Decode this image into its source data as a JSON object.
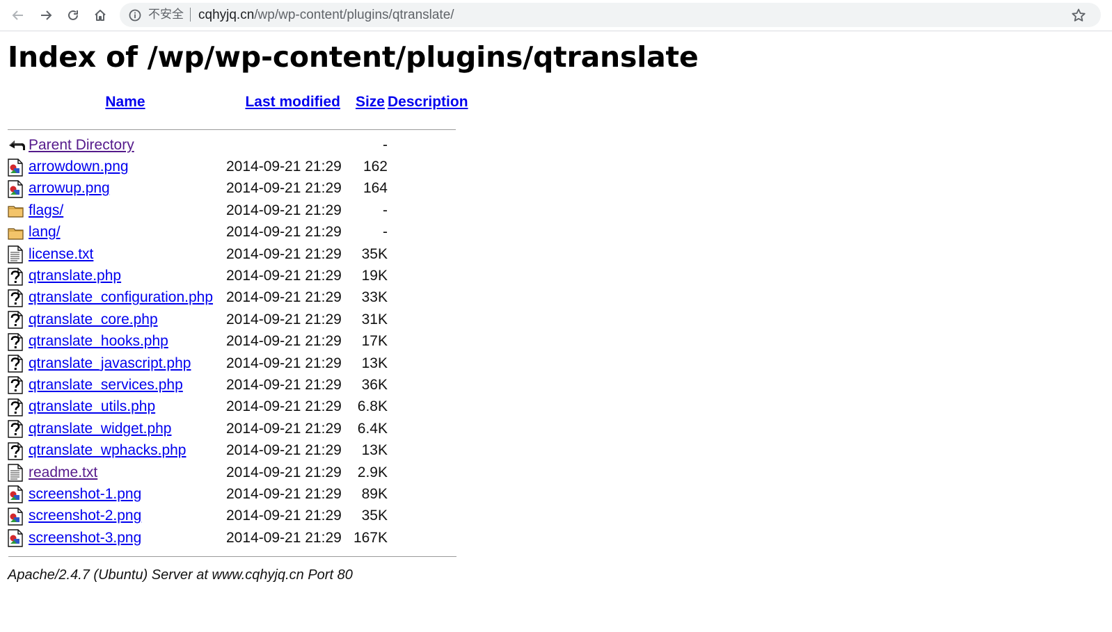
{
  "browser": {
    "insecure_label": "不安全",
    "url_host": "cqhyjq.cn",
    "url_path": "/wp/wp-content/plugins/qtranslate/"
  },
  "page": {
    "title": "Index of /wp/wp-content/plugins/qtranslate"
  },
  "table": {
    "headers": {
      "name": "Name",
      "last_modified": "Last modified",
      "size": "Size",
      "description": "Description"
    },
    "rows": [
      {
        "icon": "back-icon",
        "name": "Parent Directory",
        "modified": "",
        "size": "-",
        "visited": true
      },
      {
        "icon": "image-icon",
        "name": "arrowdown.png",
        "modified": "2014-09-21 21:29",
        "size": "162"
      },
      {
        "icon": "image-icon",
        "name": "arrowup.png",
        "modified": "2014-09-21 21:29",
        "size": "164"
      },
      {
        "icon": "folder-icon",
        "name": "flags/",
        "modified": "2014-09-21 21:29",
        "size": "-"
      },
      {
        "icon": "folder-icon",
        "name": "lang/",
        "modified": "2014-09-21 21:29",
        "size": "-"
      },
      {
        "icon": "text-icon",
        "name": "license.txt",
        "modified": "2014-09-21 21:29",
        "size": "35K"
      },
      {
        "icon": "unknown-icon",
        "name": "qtranslate.php",
        "modified": "2014-09-21 21:29",
        "size": "19K"
      },
      {
        "icon": "unknown-icon",
        "name": "qtranslate_configuration.php",
        "modified": "2014-09-21 21:29",
        "size": "33K"
      },
      {
        "icon": "unknown-icon",
        "name": "qtranslate_core.php",
        "modified": "2014-09-21 21:29",
        "size": "31K"
      },
      {
        "icon": "unknown-icon",
        "name": "qtranslate_hooks.php",
        "modified": "2014-09-21 21:29",
        "size": "17K"
      },
      {
        "icon": "unknown-icon",
        "name": "qtranslate_javascript.php",
        "modified": "2014-09-21 21:29",
        "size": "13K"
      },
      {
        "icon": "unknown-icon",
        "name": "qtranslate_services.php",
        "modified": "2014-09-21 21:29",
        "size": "36K"
      },
      {
        "icon": "unknown-icon",
        "name": "qtranslate_utils.php",
        "modified": "2014-09-21 21:29",
        "size": "6.8K"
      },
      {
        "icon": "unknown-icon",
        "name": "qtranslate_widget.php",
        "modified": "2014-09-21 21:29",
        "size": "6.4K"
      },
      {
        "icon": "unknown-icon",
        "name": "qtranslate_wphacks.php",
        "modified": "2014-09-21 21:29",
        "size": "13K"
      },
      {
        "icon": "text-icon",
        "name": "readme.txt",
        "modified": "2014-09-21 21:29",
        "size": "2.9K",
        "visited": true
      },
      {
        "icon": "image-icon",
        "name": "screenshot-1.png",
        "modified": "2014-09-21 21:29",
        "size": "89K"
      },
      {
        "icon": "image-icon",
        "name": "screenshot-2.png",
        "modified": "2014-09-21 21:29",
        "size": "35K"
      },
      {
        "icon": "image-icon",
        "name": "screenshot-3.png",
        "modified": "2014-09-21 21:29",
        "size": "167K"
      }
    ]
  },
  "footer": {
    "address": "Apache/2.4.7 (Ubuntu) Server at www.cqhyjq.cn Port 80"
  },
  "colors": {
    "link": "#0000ee",
    "visited": "#551a8b",
    "omnibox_bg": "#f1f3f4"
  }
}
